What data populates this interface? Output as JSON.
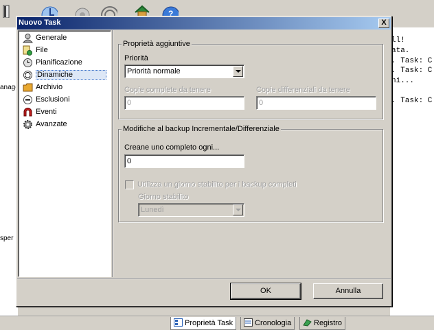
{
  "background": {
    "left_texts": [
      "anage",
      "sper"
    ],
    "log_lines": [
      "ll!",
      "ata.",
      ". Task: C",
      ". Task: C",
      "ni...",
      ". Task: C"
    ],
    "tabs": [
      {
        "label": "Proprietà Task",
        "active": true
      },
      {
        "label": "Cronologia",
        "active": false
      },
      {
        "label": "Registro",
        "active": false
      }
    ]
  },
  "dialog": {
    "title": "Nuovo Task",
    "close_glyph": "X",
    "nav_items": [
      {
        "label": "Generale",
        "icon": "user-icon"
      },
      {
        "label": "File",
        "icon": "file-icon"
      },
      {
        "label": "Pianificazione",
        "icon": "clock-icon"
      },
      {
        "label": "Dinamiche",
        "icon": "sync-icon",
        "selected": true
      },
      {
        "label": "Archivio",
        "icon": "folder-icon"
      },
      {
        "label": "Esclusioni",
        "icon": "minus-icon"
      },
      {
        "label": "Eventi",
        "icon": "magnet-icon"
      },
      {
        "label": "Avanzate",
        "icon": "gear-icon"
      }
    ],
    "group_additional": {
      "legend": "Proprietà aggiuntive",
      "priority_label": "Priorità",
      "priority_value": "Priorità normale",
      "full_copies_label": "Copie complete da tenere",
      "full_copies_value": "0",
      "diff_copies_label": "Copie differenziali da tenere",
      "diff_copies_value": "0"
    },
    "group_changes": {
      "legend": "Modifiche al backup Incrementale/Differenziale",
      "create_full_label": "Creane uno completo ogni...",
      "create_full_value": "0",
      "fixed_day_checkbox_label": "Utilizza un giorno stabilito per i backup completi",
      "fixed_day_label": "Giorno stabilito",
      "fixed_day_value": "Lunedì"
    },
    "ok_label": "OK",
    "cancel_label": "Annulla"
  }
}
